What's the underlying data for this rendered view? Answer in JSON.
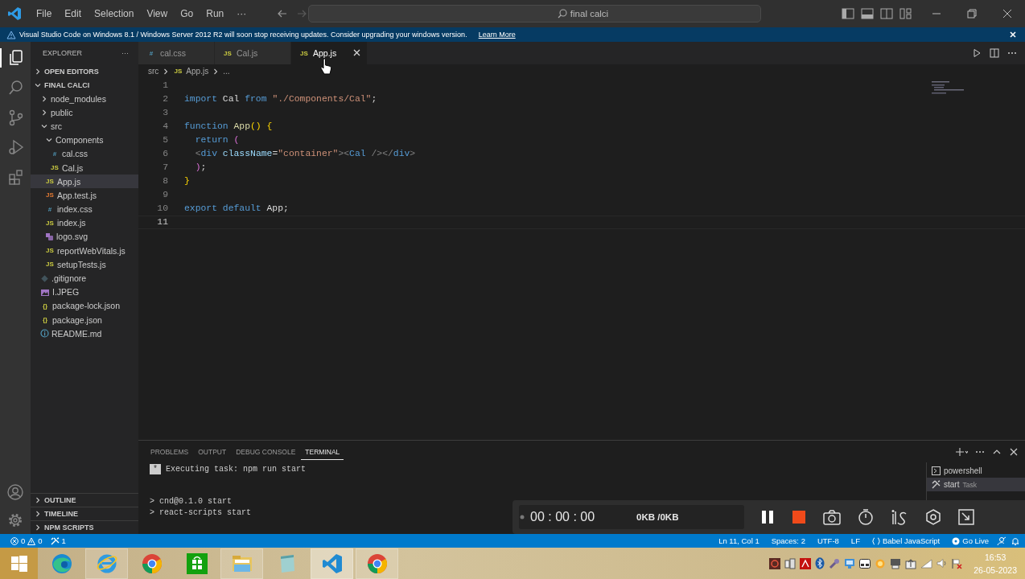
{
  "title_bar": {
    "menus": [
      "File",
      "Edit",
      "Selection",
      "View",
      "Go",
      "Run",
      "···"
    ],
    "search": "final calci"
  },
  "banner": {
    "message": "Visual Studio Code on Windows 8.1 / Windows Server 2012 R2 will soon stop receiving updates. Consider upgrading your windows version.",
    "link": "Learn More"
  },
  "activity_bar": [
    {
      "kind": "files",
      "selected": true
    },
    {
      "kind": "search",
      "selected": false
    },
    {
      "kind": "git",
      "selected": false
    },
    {
      "kind": "debug",
      "selected": false
    },
    {
      "kind": "extensions",
      "selected": false
    }
  ],
  "sidebar": {
    "title": "EXPLORER",
    "more": "···",
    "open_editors": {
      "label": "OPEN EDITORS",
      "expanded": false
    },
    "folder": {
      "label": "FINAL CALCI",
      "expanded": true,
      "children": [
        {
          "label": "node_modules",
          "kind": "folder",
          "expanded": false,
          "selected": false
        },
        {
          "label": "public",
          "kind": "folder",
          "expanded": false,
          "selected": false
        },
        {
          "label": "src",
          "kind": "folder",
          "expanded": true,
          "selected": false,
          "children": [
            {
              "label": "Components",
              "kind": "folder",
              "expanded": true,
              "selected": false,
              "children": [
                {
                  "label": "cal.css",
                  "kind": "css",
                  "icon_text": "#",
                  "selected": false
                },
                {
                  "label": "Cal.js",
                  "kind": "js",
                  "icon_text": "JS",
                  "selected": false
                }
              ]
            },
            {
              "label": "App.js",
              "kind": "js",
              "icon_text": "JS",
              "selected": true
            },
            {
              "label": "App.test.js",
              "kind": "test",
              "icon_text": "JS",
              "selected": false
            },
            {
              "label": "index.css",
              "kind": "css",
              "icon_text": "#",
              "selected": false
            },
            {
              "label": "index.js",
              "kind": "js",
              "icon_text": "JS",
              "selected": false
            },
            {
              "label": "logo.svg",
              "kind": "svg",
              "selected": false
            },
            {
              "label": "reportWebVitals.js",
              "kind": "js",
              "icon_text": "JS",
              "selected": false
            },
            {
              "label": "setupTests.js",
              "kind": "js",
              "icon_text": "JS",
              "selected": false
            }
          ]
        },
        {
          "label": ".gitignore",
          "kind": "git",
          "selected": false
        },
        {
          "label": "I.JPEG",
          "kind": "image",
          "selected": false
        },
        {
          "label": "package-lock.json",
          "kind": "json",
          "icon_text": "{}",
          "selected": false
        },
        {
          "label": "package.json",
          "kind": "json",
          "icon_text": "{}",
          "selected": false
        },
        {
          "label": "README.md",
          "kind": "info",
          "selected": false
        }
      ]
    },
    "sections": [
      {
        "label": "OUTLINE",
        "expanded": false
      },
      {
        "label": "TIMELINE",
        "expanded": false
      },
      {
        "label": "NPM SCRIPTS",
        "expanded": false
      }
    ]
  },
  "editor": {
    "tabs": [
      {
        "label": "cal.css",
        "kind": "css",
        "icon_text": "#",
        "selected": false
      },
      {
        "label": "Cal.js",
        "kind": "js",
        "icon_text": "JS",
        "selected": false
      },
      {
        "label": "App.js",
        "kind": "js",
        "icon_text": "JS",
        "selected": true
      }
    ],
    "breadcrumb": {
      "folder": "src",
      "icon_text": "JS",
      "file": "App.js",
      "more": "..."
    },
    "lines": [
      {
        "number": "1",
        "current": false
      },
      {
        "number": "2",
        "current": false,
        "tokens": [
          {
            "text": "import",
            "kind": "kw"
          },
          {
            "text": " Cal ",
            "kind": "ident"
          },
          {
            "text": "from ",
            "kind": "kw"
          },
          {
            "text": "\"./Components/Cal\"",
            "kind": "str"
          },
          {
            "text": ";",
            "kind": "punct"
          }
        ]
      },
      {
        "number": "3",
        "current": false
      },
      {
        "number": "4",
        "current": false,
        "tokens": [
          {
            "text": "function",
            "kind": "kw"
          },
          {
            "text": " App",
            "kind": "fn"
          },
          {
            "text": "() {",
            "kind": "brace"
          }
        ]
      },
      {
        "number": "5",
        "current": false,
        "tokens": [
          {
            "text": "  return",
            "kind": "kw"
          },
          {
            "text": " (",
            "kind": "paren"
          }
        ]
      },
      {
        "number": "6",
        "current": false,
        "tokens": [
          {
            "text": "  <",
            "kind": "tagp"
          },
          {
            "text": "div",
            "kind": "tag"
          },
          {
            "text": " className",
            "kind": "attr"
          },
          {
            "text": "=",
            "kind": "punct"
          },
          {
            "text": "\"container\"",
            "kind": "str"
          },
          {
            "text": "><",
            "kind": "tagp"
          },
          {
            "text": "Cal",
            "kind": "tag"
          },
          {
            "text": " /></",
            "kind": "tagp"
          },
          {
            "text": "div",
            "kind": "tag"
          },
          {
            "text": ">",
            "kind": "tagp"
          }
        ]
      },
      {
        "number": "7",
        "current": false,
        "tokens": [
          {
            "text": "  )",
            "kind": "paren"
          },
          {
            "text": ";",
            "kind": "punct"
          }
        ]
      },
      {
        "number": "8",
        "current": false,
        "tokens": [
          {
            "text": "}",
            "kind": "brace"
          }
        ]
      },
      {
        "number": "9",
        "current": false
      },
      {
        "number": "10",
        "current": false,
        "tokens": [
          {
            "text": "export default",
            "kind": "kw"
          },
          {
            "text": " App",
            "kind": "ident"
          },
          {
            "text": ";",
            "kind": "punct"
          }
        ]
      },
      {
        "number": "11",
        "current": true
      }
    ]
  },
  "panel": {
    "tabs": [
      {
        "label": "PROBLEMS",
        "selected": false
      },
      {
        "label": "OUTPUT",
        "selected": false
      },
      {
        "label": "DEBUG CONSOLE",
        "selected": false
      },
      {
        "label": "TERMINAL",
        "selected": true
      }
    ],
    "task": {
      "badge": "*",
      "text": "Executing task: npm run start"
    },
    "output": [
      "> cnd@0.1.0 start",
      "> react-scripts start"
    ],
    "terminals": [
      {
        "label": "powershell",
        "kind": "shell",
        "selected": false
      },
      {
        "label": "start",
        "detail": "Task",
        "kind": "task",
        "selected": true
      }
    ]
  },
  "recorder": {
    "time": "00 : 00 : 00",
    "size": "0KB /0KB"
  },
  "status_bar": {
    "errors": "0",
    "warnings": "0",
    "ports": "1",
    "items": [
      "Ln 11, Col 1",
      "Spaces: 2",
      "UTF-8",
      "LF"
    ],
    "language": "Babel JavaScript",
    "live": "Go Live"
  },
  "taskbar": {
    "apps": [
      {
        "kind": "edge",
        "open": false,
        "selected": false
      },
      {
        "kind": "ie",
        "open": true,
        "selected": false
      },
      {
        "kind": "chrome",
        "open": false,
        "selected": false
      },
      {
        "kind": "store",
        "open": false,
        "selected": false
      },
      {
        "kind": "explorer",
        "open": true,
        "selected": false
      },
      {
        "kind": "notepad",
        "open": false,
        "selected": false
      },
      {
        "kind": "vscode",
        "open": true,
        "selected": true
      },
      {
        "kind": "chrome",
        "open": true,
        "selected": false
      }
    ],
    "time": "16:53",
    "date": "26-05-2023"
  }
}
